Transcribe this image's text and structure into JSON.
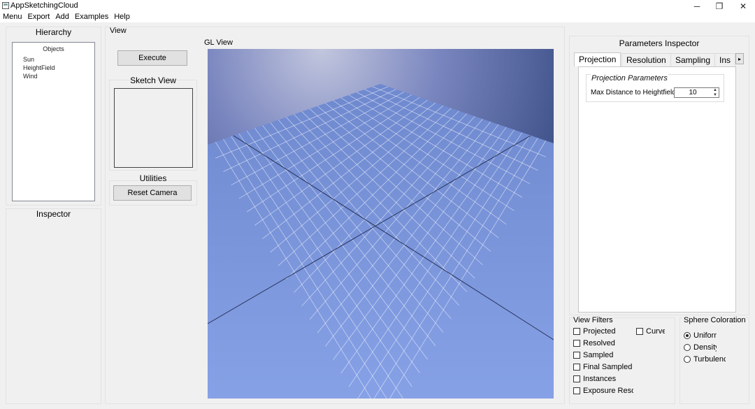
{
  "window": {
    "title": "AppSketchingCloud",
    "minimize_glyph": "─",
    "maximize_glyph": "❐",
    "close_glyph": "✕"
  },
  "menubar": {
    "items": [
      {
        "label": "Menu"
      },
      {
        "label": "Export"
      },
      {
        "label": "Add"
      },
      {
        "label": "Examples"
      },
      {
        "label": "Help"
      }
    ]
  },
  "hierarchy": {
    "title": "Hierarchy",
    "header": "Objects",
    "items": [
      {
        "label": "Sun"
      },
      {
        "label": "HeightField"
      },
      {
        "label": "Wind"
      }
    ]
  },
  "inspector": {
    "title": "Inspector"
  },
  "view": {
    "title": "View",
    "execute_label": "Execute",
    "sketch_title": "Sketch View",
    "utilities_title": "Utilities",
    "reset_camera_label": "Reset Camera",
    "gl_title": "GL View"
  },
  "params": {
    "title": "Parameters Inspector",
    "tabs": [
      {
        "label": "Projection"
      },
      {
        "label": "Resolution"
      },
      {
        "label": "Sampling"
      },
      {
        "label": "Ins"
      }
    ],
    "tab_scroll_glyph": "▸",
    "group_title": "Projection Parameters",
    "max_distance_label": "Max Distance to Heightfield",
    "max_distance_value": "10",
    "spin_up": "▲",
    "spin_down": "▼"
  },
  "view_filters": {
    "title": "View Filters",
    "items": [
      {
        "label": "Projected",
        "checked": false
      },
      {
        "label": "Curves",
        "checked": false
      },
      {
        "label": "Resolved",
        "checked": false
      },
      {
        "label": "Sampled",
        "checked": false
      },
      {
        "label": "Final Sampled",
        "checked": false
      },
      {
        "label": "Instances",
        "checked": false
      },
      {
        "label": "Exposure Resolv",
        "checked": false
      }
    ]
  },
  "sphere_coloration": {
    "title": "Sphere Coloration",
    "options": [
      {
        "label": "Uniform",
        "checked": true
      },
      {
        "label": "Density",
        "checked": false
      },
      {
        "label": "Turbulenc",
        "checked": false
      }
    ]
  },
  "colors": {
    "sky_top": "#3d5088",
    "sky_glow": "#c2c6de",
    "floor": "#7d9adf",
    "grid_line": "#ffffff",
    "axis_line": "#1f2a4d"
  }
}
